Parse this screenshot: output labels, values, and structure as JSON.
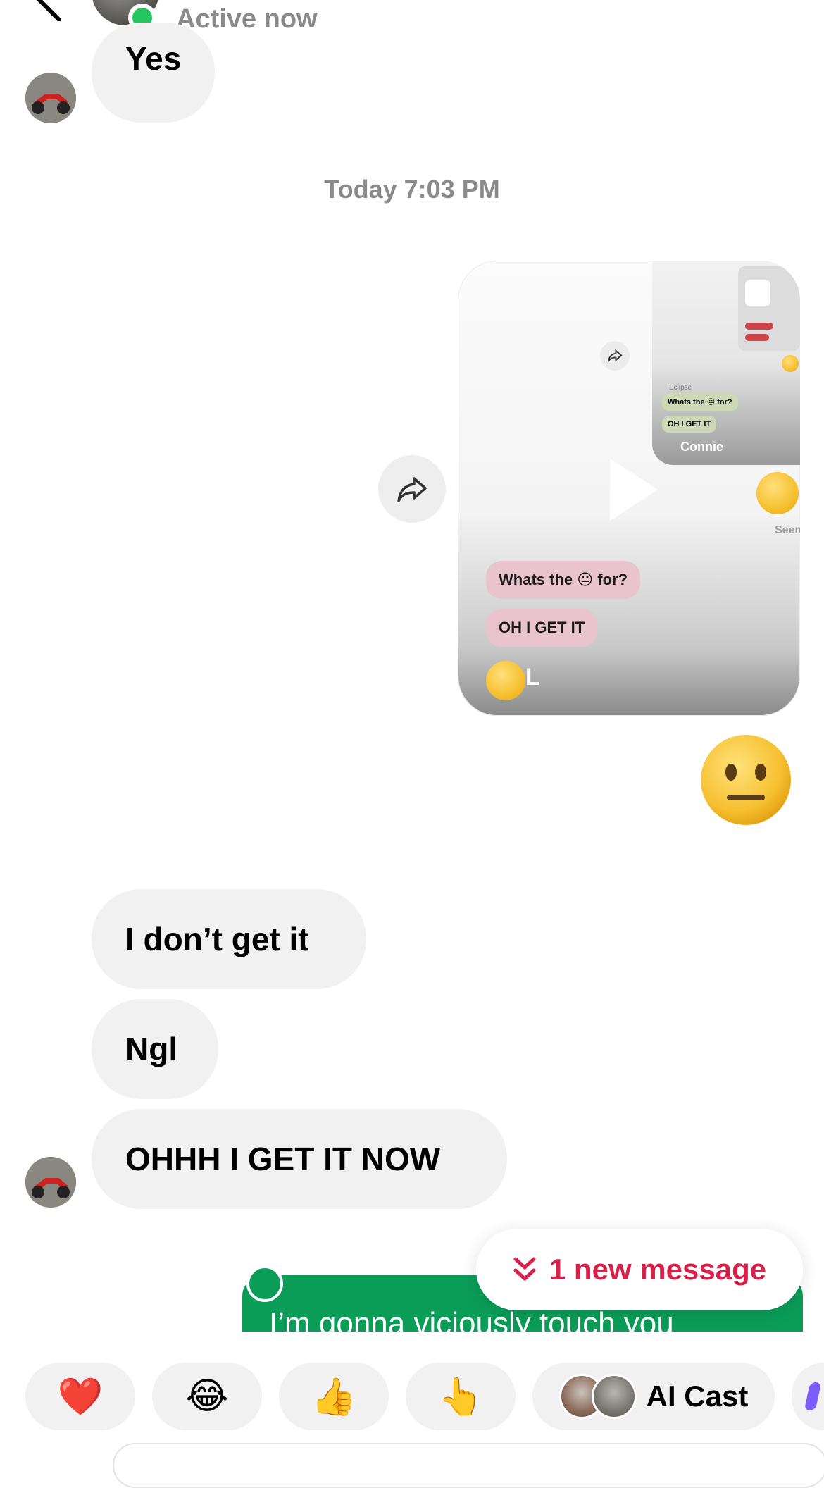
{
  "header": {
    "status_text": "Active now",
    "icons": {
      "back": "chevron-left-icon",
      "more": "more-horizontal-icon"
    }
  },
  "messages": [
    {
      "from": "them",
      "text": "Yes"
    },
    {
      "timestamp": "Today 7:03 PM"
    },
    {
      "from": "me",
      "type": "video",
      "embedded": {
        "bubbles": [
          "Whats the 😐 for?",
          "OH I GET IT"
        ],
        "inner_bubbles": [
          "Whats the 😐 for?",
          "OH I GET IT"
        ],
        "inner_name": "Connie",
        "inner_top_text": "Eclipse",
        "sender_initial": "L",
        "seen": "Seen"
      }
    },
    {
      "from": "me",
      "type": "emoji",
      "text": "😐"
    },
    {
      "from": "them",
      "text": "I don’t get it"
    },
    {
      "from": "them",
      "text": "Ngl"
    },
    {
      "from": "them",
      "text": "OHHH I GET IT NOW"
    },
    {
      "from": "me",
      "type": "note",
      "text": "I’m gonna viciously touch you"
    }
  ],
  "new_message_pill": {
    "text": "1 new message",
    "color": "#d6214b"
  },
  "quick_reactions": {
    "items": [
      "❤️",
      "😂",
      "👍",
      "👆"
    ],
    "ai_cast_label": "AI Cast"
  },
  "colors": {
    "accent_green": "#0a9d58",
    "online": "#22c55e",
    "bubble": "#f1f1f2"
  }
}
